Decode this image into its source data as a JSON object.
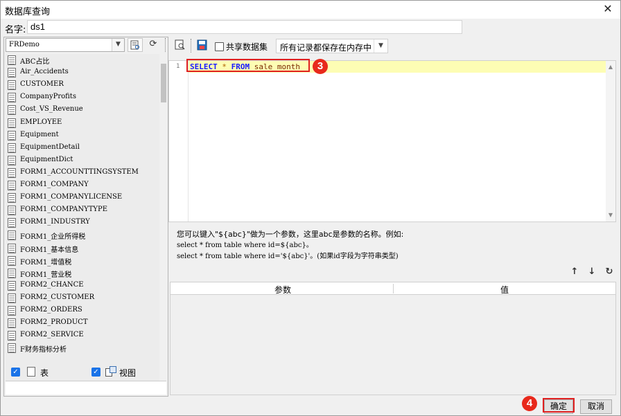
{
  "window": {
    "title": "数据库查询",
    "close_symbol": "✕"
  },
  "name_field": {
    "label": "名字:",
    "value": "ds1"
  },
  "left_pane": {
    "database_select": "FRDemo",
    "tables": [
      "ABC占比",
      "Air_Accidents",
      "CUSTOMER",
      "CompanyProfits",
      "Cost_VS_Revenue",
      "EMPLOYEE",
      "Equipment",
      "EquipmentDetail",
      "EquipmentDict",
      "FORM1_ACCOUNTTINGSYSTEM",
      "FORM1_COMPANY",
      "FORM1_COMPANYLICENSE",
      "FORM1_COMPANYTYPE",
      "FORM1_INDUSTRY",
      "FORM1_企业所得税",
      "FORM1_基本信息",
      "FORM1_增值税",
      "FORM1_营业税",
      "FORM2_CHANCE",
      "FORM2_CUSTOMER",
      "FORM2_ORDERS",
      "FORM2_PRODUCT",
      "FORM2_SERVICE",
      "F财务指标分析"
    ],
    "filter": {
      "table_label": "表",
      "view_label": "视图",
      "table_checked": true,
      "view_checked": true
    }
  },
  "right_toolbar": {
    "share_label": "共享数据集",
    "share_checked": false,
    "memory_select": "所有记录都保存在内存中"
  },
  "editor": {
    "line_number": "1",
    "sql_tokens": {
      "select": "SELECT",
      "star": "*",
      "from": "FROM",
      "table": "sale month"
    }
  },
  "annotations": {
    "step_sql": "3",
    "step_ok": "4",
    "highlight_color": "#e02020"
  },
  "hint": {
    "line1": "您可以键入\"${abc}\"做为一个参数，这里abc是参数的名称。例如:",
    "line2": "select * from table where id=${abc}。",
    "line3": "select * from table where id='${abc}'。(如果id字段为字符串类型)"
  },
  "param_table": {
    "col_param": "参数",
    "col_value": "值"
  },
  "footer": {
    "ok_label": "确定",
    "cancel_label": "取消"
  }
}
